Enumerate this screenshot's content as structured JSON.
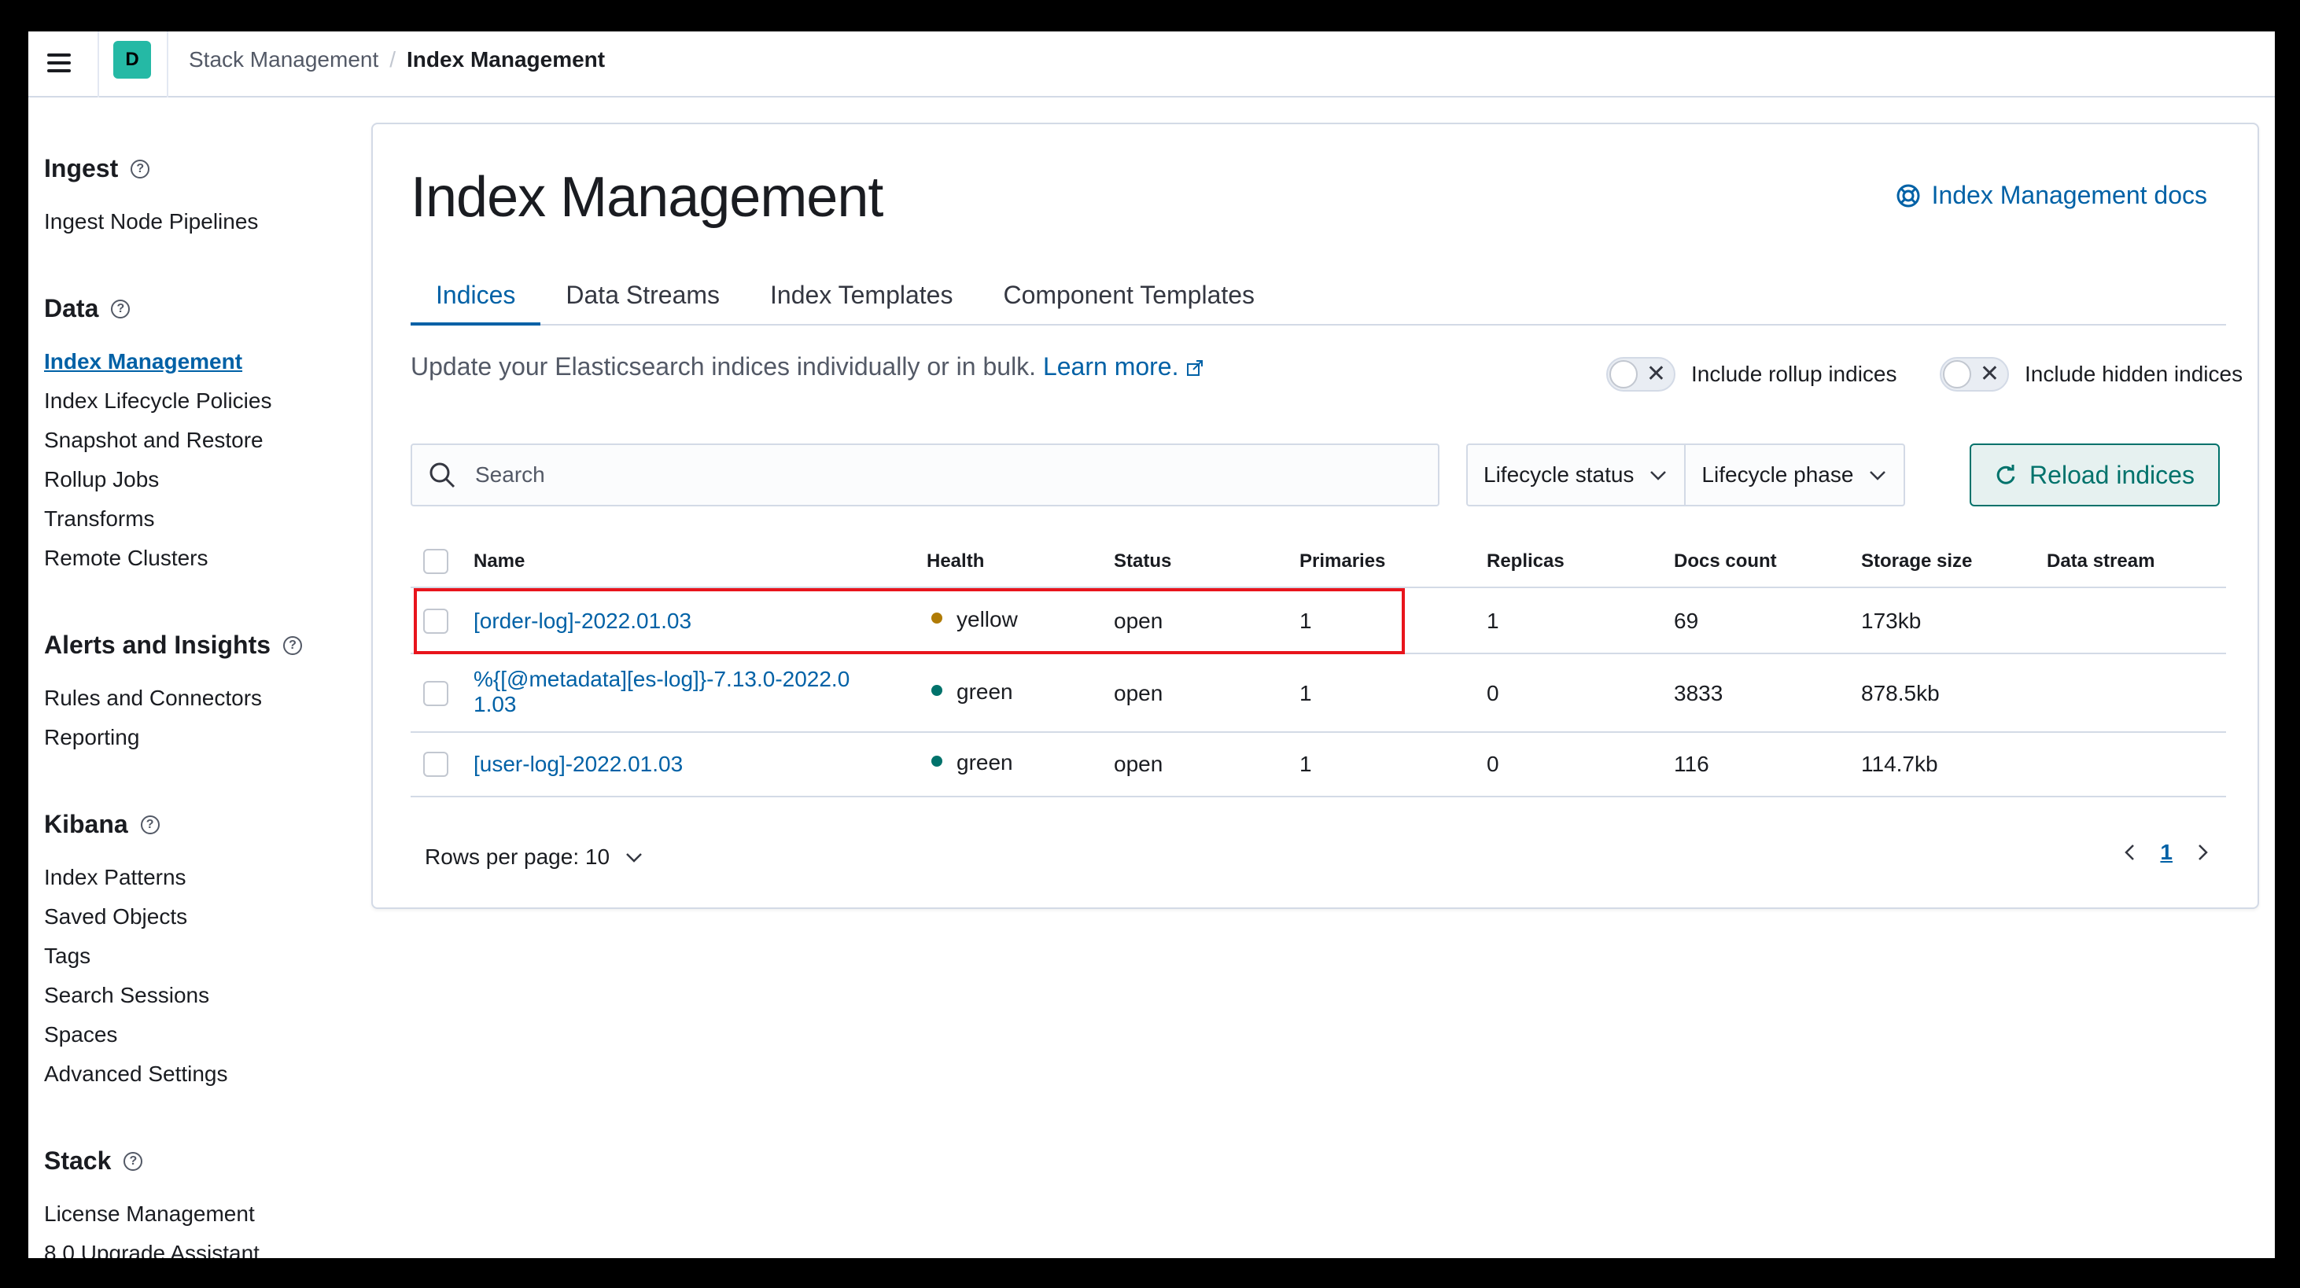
{
  "header": {
    "space_initial": "D",
    "breadcrumbs": [
      "Stack Management",
      "Index Management"
    ]
  },
  "sidebar": {
    "groups": [
      {
        "title": "Ingest",
        "items": [
          "Ingest Node Pipelines"
        ]
      },
      {
        "title": "Data",
        "items": [
          "Index Management",
          "Index Lifecycle Policies",
          "Snapshot and Restore",
          "Rollup Jobs",
          "Transforms",
          "Remote Clusters"
        ]
      },
      {
        "title": "Alerts and Insights",
        "items": [
          "Rules and Connectors",
          "Reporting"
        ]
      },
      {
        "title": "Kibana",
        "items": [
          "Index Patterns",
          "Saved Objects",
          "Tags",
          "Search Sessions",
          "Spaces",
          "Advanced Settings"
        ]
      },
      {
        "title": "Stack",
        "items": [
          "License Management",
          "8.0 Upgrade Assistant"
        ]
      }
    ],
    "active_item": "Index Management"
  },
  "main": {
    "title": "Index Management",
    "docs_link": "Index Management docs",
    "tabs": [
      "Indices",
      "Data Streams",
      "Index Templates",
      "Component Templates"
    ],
    "active_tab": "Indices",
    "description": "Update your Elasticsearch indices individually or in bulk.",
    "learn_more": "Learn more.",
    "toggles": [
      "Include rollup indices",
      "Include hidden indices"
    ],
    "search_placeholder": "Search",
    "filters": [
      "Lifecycle status",
      "Lifecycle phase"
    ],
    "reload_label": "Reload indices"
  },
  "table": {
    "columns": [
      "Name",
      "Health",
      "Status",
      "Primaries",
      "Replicas",
      "Docs count",
      "Storage size",
      "Data stream"
    ],
    "rows": [
      {
        "name": "[order-log]-2022.01.03",
        "health": "yellow",
        "status": "open",
        "primaries": "1",
        "replicas": "1",
        "docs_count": "69",
        "storage_size": "173kb"
      },
      {
        "name_line1": "%{[@metadata][es-log]}-7.13.0-2022.0",
        "name_line2": "1.03",
        "health": "green",
        "status": "open",
        "primaries": "1",
        "replicas": "0",
        "docs_count": "3833",
        "storage_size": "878.5kb"
      },
      {
        "name": "[user-log]-2022.01.03",
        "health": "green",
        "status": "open",
        "primaries": "1",
        "replicas": "0",
        "docs_count": "116",
        "storage_size": "114.7kb"
      }
    ]
  },
  "pagination": {
    "rows_per_page": "Rows per page: 10",
    "current_page": "1"
  },
  "colors": {
    "yellow": "#b07b05",
    "green": "#00726b",
    "link": "#0061a6",
    "highlight": "#e8141c"
  }
}
